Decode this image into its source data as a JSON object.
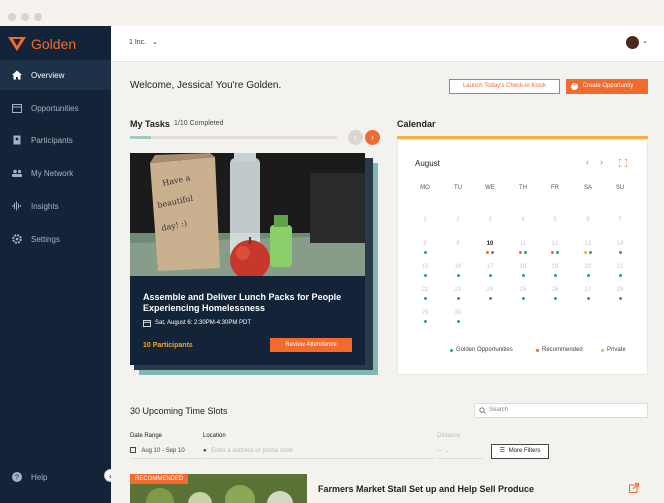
{
  "brand": {
    "name": "Golden"
  },
  "sidebar": {
    "items": [
      {
        "label": "Overview",
        "icon": "home-icon"
      },
      {
        "label": "Opportunities",
        "icon": "calendar-icon"
      },
      {
        "label": "Participants",
        "icon": "badge-icon"
      },
      {
        "label": "My Network",
        "icon": "people-icon"
      },
      {
        "label": "Insights",
        "icon": "waveform-icon"
      },
      {
        "label": "Settings",
        "icon": "gear-icon"
      }
    ],
    "help": "Help"
  },
  "topbar": {
    "org": "1 Inc."
  },
  "welcome": "Welcome, Jessica! You're Golden.",
  "actions": {
    "kiosk": "Launch Today's Check-in Kiosk",
    "create": "Create Opportunity"
  },
  "tasks": {
    "title": "My Tasks",
    "completed": "1/10 Completed",
    "progress": 0.1,
    "card": {
      "title": "Assemble and Deliver Lunch Packs for People Experiencing Homelessness",
      "date": "Sat, August 6: 2:30PM-4:30PM PDT",
      "participants": "10 Participants",
      "button": "Review Attendance",
      "bag_text": "Have a beautiful day! :)"
    }
  },
  "calendar": {
    "title": "Calendar",
    "month": "August",
    "weekdays": [
      "MO",
      "TU",
      "WE",
      "TH",
      "FR",
      "SA",
      "SU"
    ],
    "weeks": [
      [
        "1",
        "2",
        "3",
        "4",
        "5",
        "6",
        "7"
      ],
      [
        "8",
        "9",
        "10",
        "11",
        "12",
        "13",
        "14"
      ],
      [
        "15",
        "16",
        "17",
        "18",
        "19",
        "20",
        "21"
      ],
      [
        "22",
        "23",
        "24",
        "25",
        "26",
        "27",
        "28"
      ],
      [
        "29",
        "30",
        "",
        "",
        "",
        "",
        ""
      ]
    ],
    "today": "10",
    "legend": [
      "Golden Opportunities",
      "Recommended",
      "Private"
    ],
    "colors": {
      "golden": "#2fa36b",
      "recommended": "#f26a2e",
      "private": "#f5b13d"
    }
  },
  "slots": {
    "title": "30 Upcoming Time Slots",
    "search_placeholder": "Search",
    "date_range_label": "Date Range",
    "date_range_value": "Aug 10 - Sep 10",
    "location_label": "Location",
    "location_placeholder": "Enter a address or postal code",
    "distance_label": "Distance",
    "more_filters": "More Filters"
  },
  "recommended": {
    "badge": "RECOMMENDED",
    "title": "Farmers Market Stall Set up and Help Sell Produce"
  }
}
